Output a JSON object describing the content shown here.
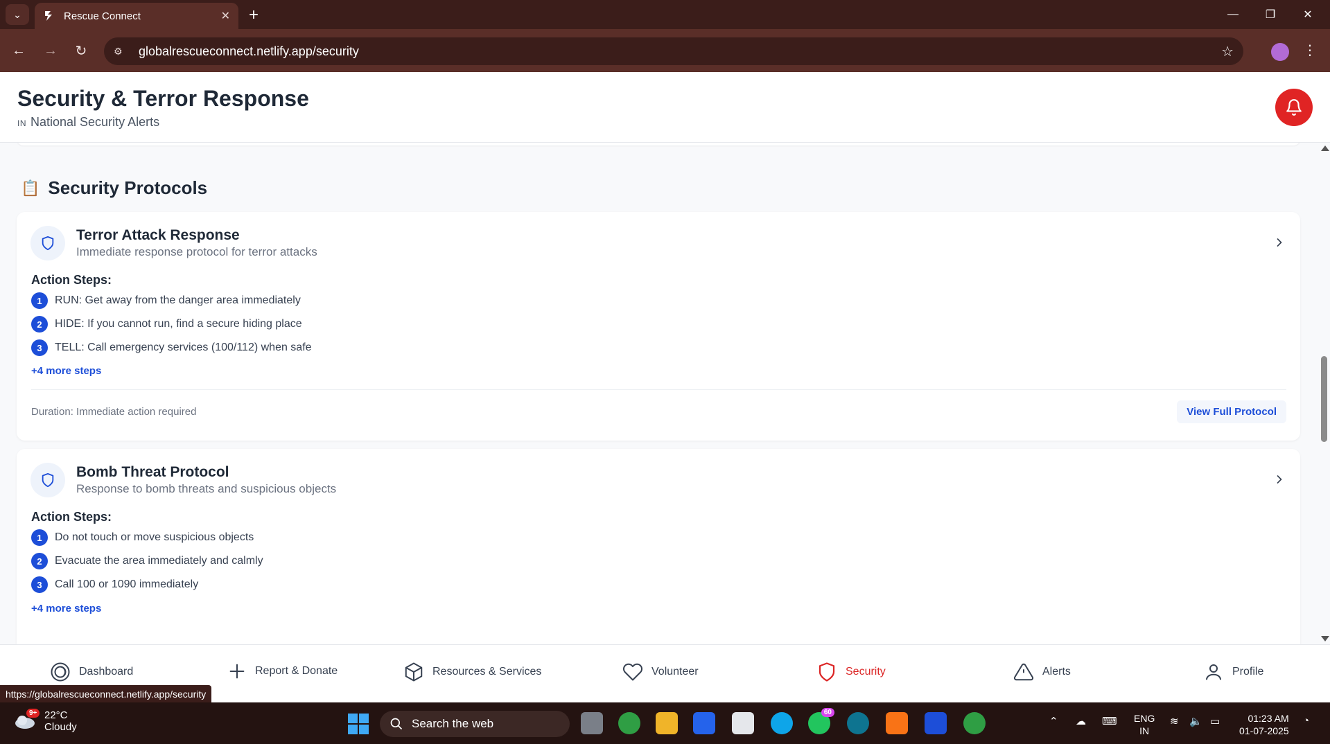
{
  "browser": {
    "tab_title": "Rescue Connect",
    "url": "globalrescueconnect.netlify.app/security",
    "status_url": "https://globalrescueconnect.netlify.app/security"
  },
  "header": {
    "title": "Security & Terror Response",
    "subtitle_prefix": "IN",
    "subtitle": "National Security Alerts"
  },
  "section": {
    "emoji": "📋",
    "title": "Security Protocols"
  },
  "protocols": [
    {
      "title": "Terror Attack Response",
      "description": "Immediate response protocol for terror attacks",
      "steps_label": "Action Steps:",
      "steps": [
        {
          "num": "1",
          "text": "RUN: Get away from the danger area immediately"
        },
        {
          "num": "2",
          "text": "HIDE: If you cannot run, find a secure hiding place"
        },
        {
          "num": "3",
          "text": "TELL: Call emergency services (100/112) when safe"
        }
      ],
      "more_steps": "+4 more steps",
      "duration": "Duration: Immediate action required",
      "view_label": "View Full Protocol"
    },
    {
      "title": "Bomb Threat Protocol",
      "description": "Response to bomb threats and suspicious objects",
      "steps_label": "Action Steps:",
      "steps": [
        {
          "num": "1",
          "text": "Do not touch or move suspicious objects"
        },
        {
          "num": "2",
          "text": "Evacuate the area immediately and calmly"
        },
        {
          "num": "3",
          "text": "Call 100 or 1090 immediately"
        }
      ],
      "more_steps": "+4 more steps"
    }
  ],
  "bottom_nav": [
    {
      "label": "Dashboard",
      "icon": "dashboard-icon",
      "active": false
    },
    {
      "label": "Report & Donate",
      "icon": "plus-icon",
      "active": false
    },
    {
      "label": "Resources & Services",
      "icon": "box-icon",
      "active": false
    },
    {
      "label": "Volunteer",
      "icon": "heart-icon",
      "active": false
    },
    {
      "label": "Security",
      "icon": "shield-icon",
      "active": true
    },
    {
      "label": "Alerts",
      "icon": "warning-icon",
      "active": false
    },
    {
      "label": "Profile",
      "icon": "user-icon",
      "active": false
    }
  ],
  "taskbar": {
    "weather_badge": "9+",
    "temperature": "22°C",
    "condition": "Cloudy",
    "search_placeholder": "Search the web",
    "whatsapp_badge": "60",
    "language_line1": "ENG",
    "language_line2": "IN",
    "time": "01:23 AM",
    "date": "01-07-2025"
  },
  "colors": {
    "accent_blue": "#1d4ed8",
    "active_red": "#dc2626",
    "bell_red": "#e02424",
    "browser_frame": "#5a2e28"
  }
}
